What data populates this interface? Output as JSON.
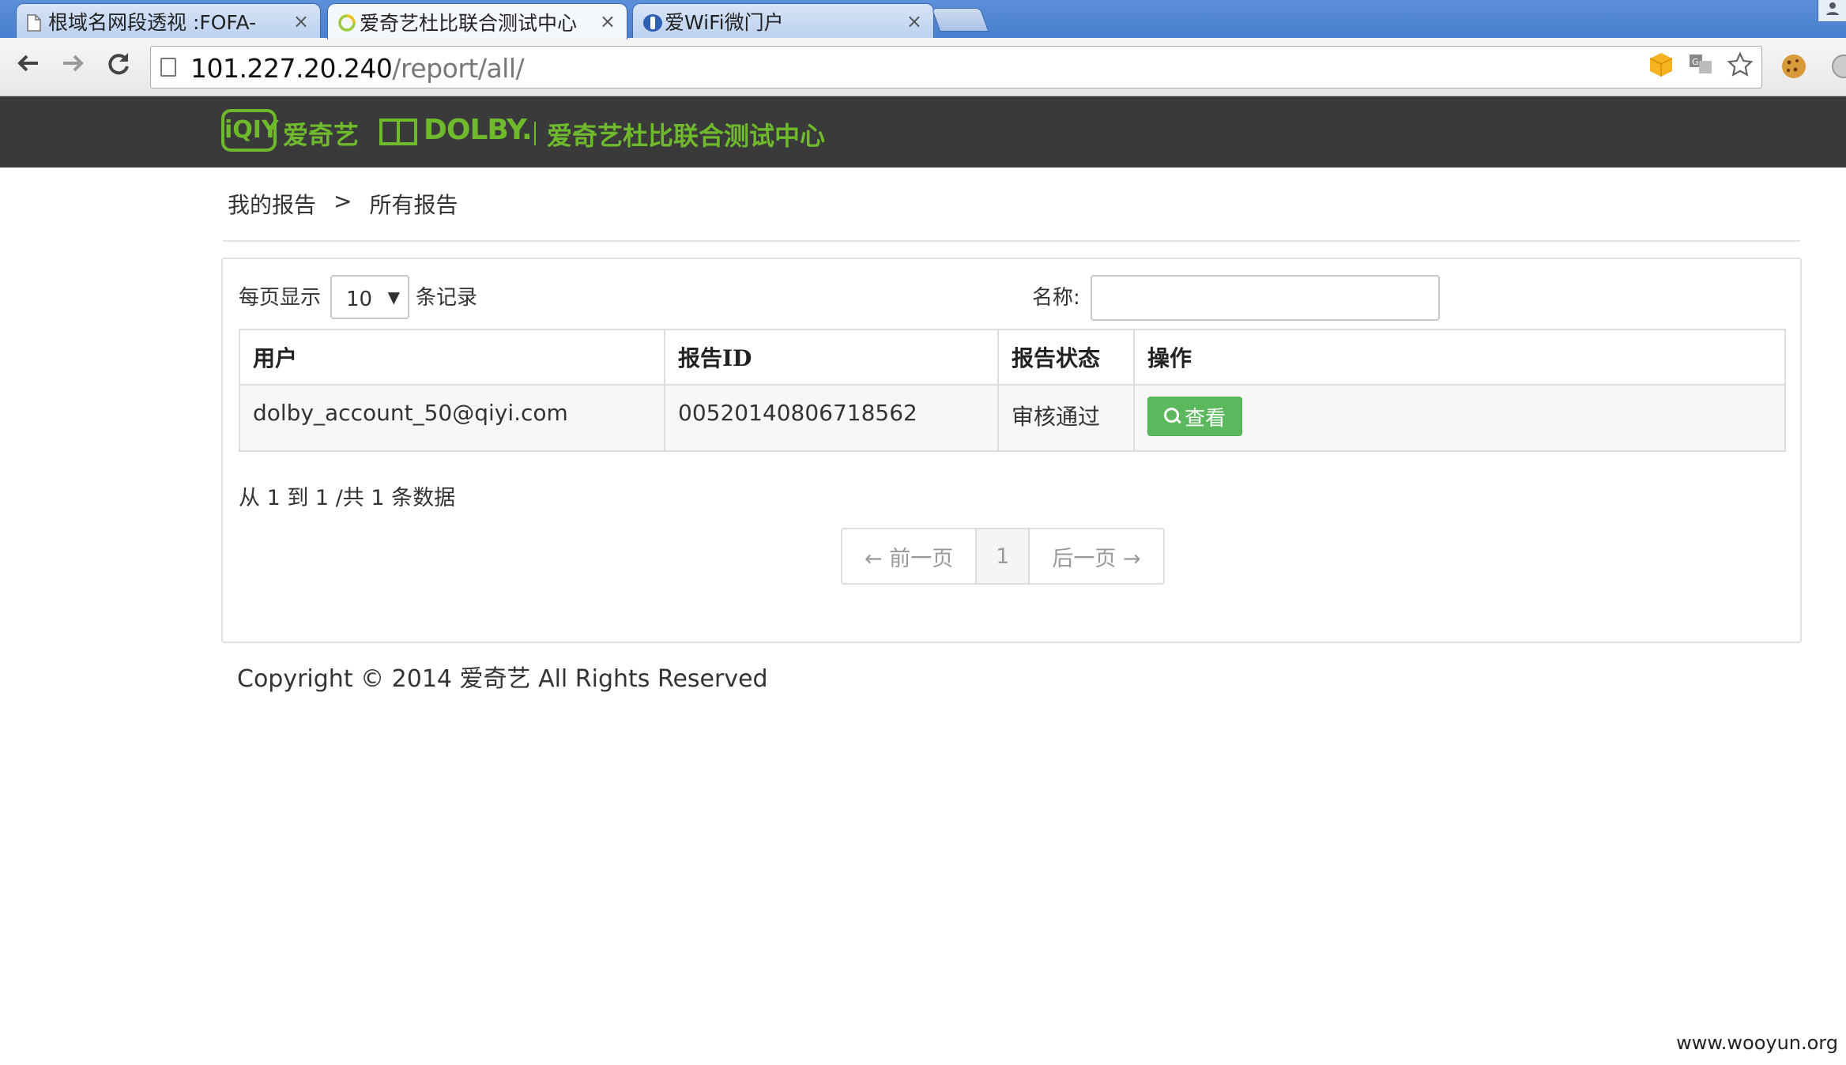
{
  "browser": {
    "tabs": [
      {
        "title": "根域名网段透视 :FOFA-"
      },
      {
        "title": "爱奇艺杜比联合测试中心"
      },
      {
        "title": "爱WiFi微门户"
      }
    ],
    "tab_close_glyph": "×",
    "url_host": "101.227.20.240",
    "url_path": "/report/all/",
    "icons": {
      "back": "back-arrow-icon",
      "forward": "forward-arrow-icon",
      "reload": "reload-icon",
      "star": "bookmark-star-icon"
    }
  },
  "header": {
    "brand_logo": "iQIY",
    "brand_cn": "爱奇艺",
    "dolby": "DOLBY.",
    "center_title": "爱奇艺杜比联合测试中心",
    "accent_color": "#6fba2c"
  },
  "breadcrumb": {
    "home": "我的报告",
    "separator": ">",
    "current": "所有报告"
  },
  "table_controls": {
    "length_prefix": "每页显示",
    "length_value": "10",
    "length_suffix": "条记录",
    "search_label": "名称:",
    "search_value": ""
  },
  "table": {
    "columns": [
      "用户",
      "报告ID",
      "报告状态",
      "操作"
    ],
    "rows": [
      {
        "user": "dolby_account_50@qiyi.com",
        "report_id": "00520140806718562",
        "status": "审核通过",
        "action": "查看"
      }
    ]
  },
  "info": "从 1 到 1 /共 1 条数据",
  "pagination": {
    "prev": "← 前一页",
    "page": "1",
    "next": "后一页 →"
  },
  "footer": {
    "copyright": "Copyright © 2014 爱奇艺 All Rights Reserved"
  },
  "watermark": "www.wooyun.org"
}
